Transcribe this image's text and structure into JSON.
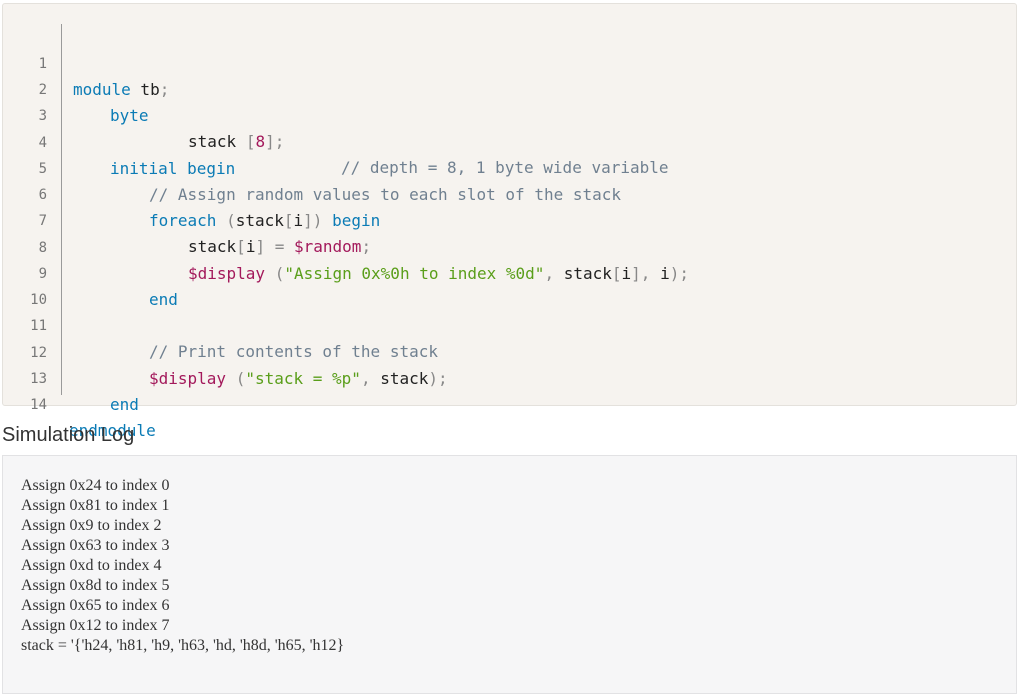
{
  "code": {
    "line_numbers": [
      "1",
      "2",
      "3",
      "4",
      "5",
      "6",
      "7",
      "8",
      "9",
      "10",
      "11",
      "12",
      "13",
      "14"
    ],
    "l1": {
      "kw": "module",
      "rest": " tb",
      "semi": ";"
    },
    "l2": {
      "kw": "byte",
      "name": "stack",
      "lbr": "[",
      "num": "8",
      "rbr": "];",
      "comment": "// depth = 8, 1 byte wide variable"
    },
    "l4": {
      "kw": "initial begin"
    },
    "l5": {
      "comment": "// Assign random values to each slot of the stack"
    },
    "l6": {
      "kw": "foreach",
      "open": "(",
      "name": "stack",
      "lbr": "[",
      "idx": "i",
      "rbr": "])",
      "kw2": "begin"
    },
    "l7": {
      "name": "stack",
      "lbr": "[",
      "idx": "i",
      "rbr": "]",
      "eq": " = ",
      "fn": "$random",
      "semi": ";"
    },
    "l8": {
      "fn": "$display",
      "open": "(",
      "str": "\"Assign 0x%0h to index %0d\"",
      "comma": ", ",
      "name": "stack",
      "lbr": "[",
      "idx": "i",
      "rbr": "], ",
      "i": "i",
      "close": ");"
    },
    "l9": {
      "kw": "end"
    },
    "l11": {
      "comment": "// Print contents of the stack"
    },
    "l12": {
      "fn": "$display",
      "open": "(",
      "str": "\"stack = %p\"",
      "comma": ", ",
      "name": "stack",
      "close": ");"
    },
    "l13": {
      "kw": "end"
    },
    "l14": {
      "kw": "endmodule"
    }
  },
  "log": {
    "title": "Simulation Log",
    "lines": [
      "Assign 0x24 to index 0",
      "Assign 0x81 to index 1",
      "Assign 0x9 to index 2",
      "Assign 0x63 to index 3",
      "Assign 0xd to index 4",
      "Assign 0x8d to index 5",
      "Assign 0x65 to index 6",
      "Assign 0x12 to index 7",
      "stack = '{'h24, 'h81, 'h9, 'h63, 'hd, 'h8d, 'h65, 'h12}"
    ]
  }
}
